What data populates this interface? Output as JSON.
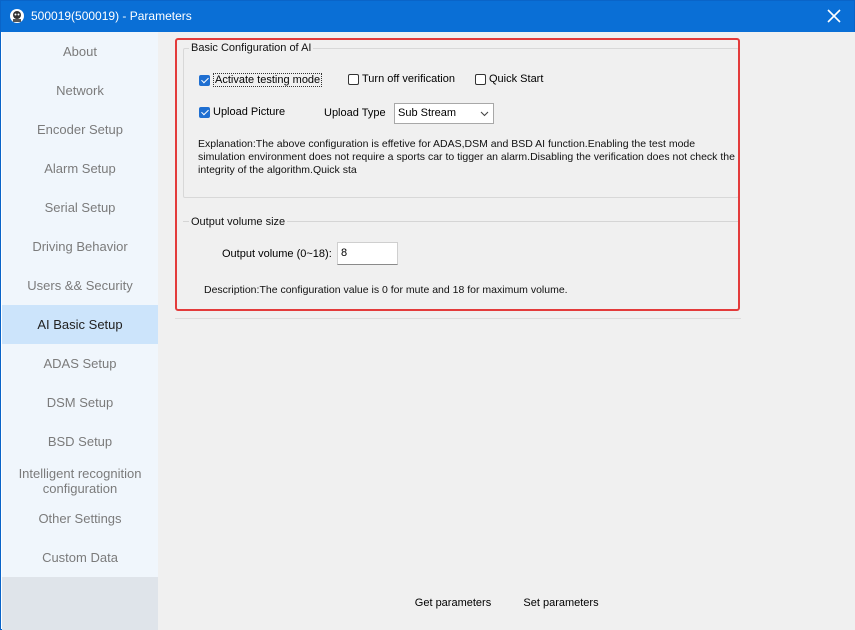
{
  "window": {
    "title": "500019(500019) - Parameters"
  },
  "sidebar": {
    "items": [
      {
        "label": "About"
      },
      {
        "label": "Network"
      },
      {
        "label": "Encoder Setup"
      },
      {
        "label": "Alarm Setup"
      },
      {
        "label": "Serial Setup"
      },
      {
        "label": "Driving Behavior"
      },
      {
        "label": "Users && Security"
      },
      {
        "label": "AI Basic Setup",
        "active": true
      },
      {
        "label": "ADAS Setup"
      },
      {
        "label": "DSM Setup"
      },
      {
        "label": "BSD Setup"
      },
      {
        "label": "Intelligent recognition configuration"
      },
      {
        "label": "Other Settings"
      },
      {
        "label": "Custom Data"
      }
    ]
  },
  "basic": {
    "legend": "Basic Configuration of AI",
    "activate_testing_mode": {
      "label": "Activate testing mode",
      "checked": true
    },
    "turn_off_verification": {
      "label": "Turn off verification",
      "checked": false
    },
    "quick_start": {
      "label": "Quick Start",
      "checked": false
    },
    "upload_picture": {
      "label": "Upload Picture",
      "checked": true
    },
    "upload_type_label": "Upload Type",
    "upload_type_value": "Sub Stream",
    "explanation": "Explanation:The above configuration is effetive for ADAS,DSM and BSD AI function.Enabling the test mode simulation environment does not require a sports car to tigger an alarm.Disabling the verification does not check the integrity of the algorithm.Quick sta"
  },
  "volume": {
    "legend": "Output volume size",
    "label": "Output volume (0~18):",
    "value": "8",
    "description": "Description:The configuration value is 0 for mute and 18 for maximum volume."
  },
  "footer": {
    "get_label": "Get parameters",
    "set_label": "Set parameters"
  },
  "colors": {
    "titlebar": "#0a6fd6",
    "highlight_box": "#e33b3b",
    "sidebar_active": "#cce4fb",
    "checkbox_checked": "#1f6fd1"
  },
  "icons": {
    "app": "app-icon",
    "close": "close-icon",
    "dropdown": "chevron-down-icon"
  }
}
